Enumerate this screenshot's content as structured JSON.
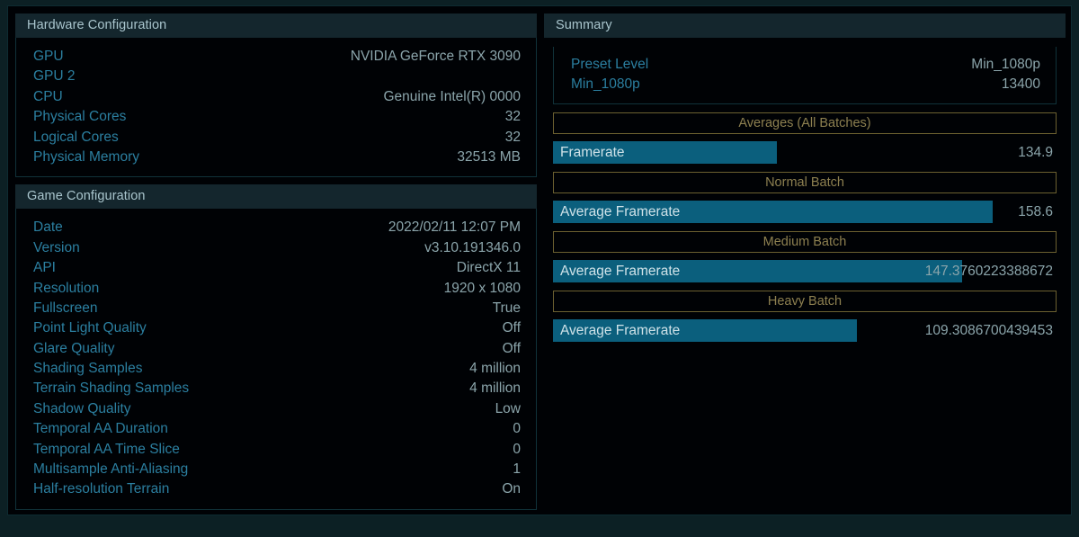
{
  "theme": {
    "frame_bg": "#0c2024",
    "stage_bg": "#000205",
    "panel_header_bg": "#14262d",
    "panel_header_text": "#a9c5cd",
    "label_color": "#2b7fa0",
    "value_color": "#8ba5ab",
    "bar_fill": "#0b5f7d",
    "bar_label_color": "#cfe2e8",
    "batch_border": "#6b6030",
    "batch_text": "#8d8050",
    "panel_border": "#10323a"
  },
  "hardware": {
    "title": "Hardware Configuration",
    "rows": [
      {
        "label": "GPU",
        "value": "NVIDIA GeForce RTX 3090"
      },
      {
        "label": "GPU 2",
        "value": ""
      },
      {
        "label": "CPU",
        "value": "Genuine Intel(R) 0000"
      },
      {
        "label": "Physical Cores",
        "value": "32"
      },
      {
        "label": "Logical Cores",
        "value": "32"
      },
      {
        "label": "Physical Memory",
        "value": "32513 MB"
      }
    ]
  },
  "game": {
    "title": "Game Configuration",
    "rows": [
      {
        "label": "Date",
        "value": "2022/02/11 12:07 PM"
      },
      {
        "label": "Version",
        "value": "v3.10.191346.0"
      },
      {
        "label": "API",
        "value": "DirectX 11"
      },
      {
        "label": "Resolution",
        "value": "1920 x 1080"
      },
      {
        "label": "Fullscreen",
        "value": "True"
      },
      {
        "label": "Point Light Quality",
        "value": "Off"
      },
      {
        "label": "Glare Quality",
        "value": "Off"
      },
      {
        "label": "Shading Samples",
        "value": "4 million"
      },
      {
        "label": "Terrain Shading Samples",
        "value": "4 million"
      },
      {
        "label": "Shadow Quality",
        "value": "Low"
      },
      {
        "label": "Temporal AA Duration",
        "value": "0"
      },
      {
        "label": "Temporal AA Time Slice",
        "value": "0"
      },
      {
        "label": "Multisample Anti-Aliasing",
        "value": "1"
      },
      {
        "label": "Half-resolution Terrain",
        "value": "On"
      }
    ]
  },
  "summary": {
    "title": "Summary",
    "rows": [
      {
        "label": "Preset Level",
        "value": "Min_1080p"
      },
      {
        "label": "Min_1080p",
        "value": "13400"
      }
    ],
    "sections": [
      {
        "box_label": "Averages (All Batches)",
        "metric": {
          "label": "Framerate",
          "value": "134.9",
          "bar_pct": 44.4
        }
      },
      {
        "box_label": "Normal Batch",
        "metric": {
          "label": "Average Framerate",
          "value": "158.6",
          "bar_pct": 87.3
        }
      },
      {
        "box_label": "Medium Batch",
        "metric": {
          "label": "Average Framerate",
          "value": "147.3760223388672",
          "bar_pct": 81.2
        }
      },
      {
        "box_label": "Heavy Batch",
        "metric": {
          "label": "Average Framerate",
          "value": "109.3086700439453",
          "bar_pct": 60.4
        }
      }
    ]
  }
}
